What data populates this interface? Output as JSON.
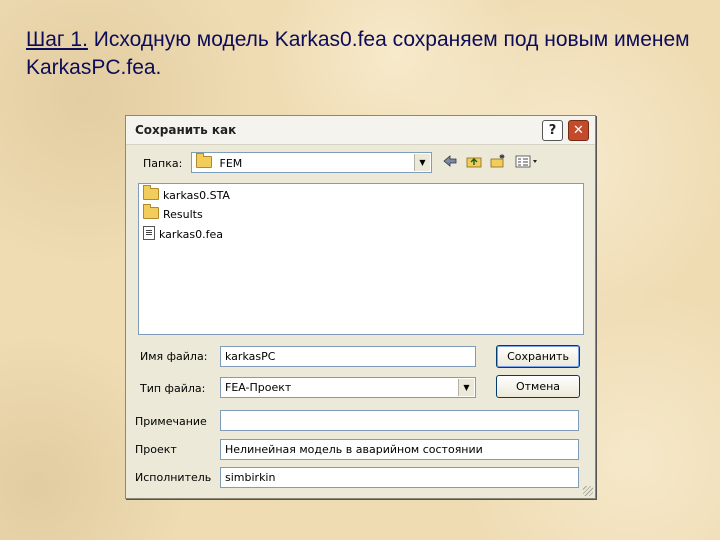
{
  "slide": {
    "step": "Шаг 1.",
    "text": " Исходную модель Karkas0.fea сохраняем под новым именем KarkasPC.fea."
  },
  "dialog": {
    "title": "Сохранить как",
    "help_label": "?",
    "close_label": "✕",
    "folder_label": "Папка:",
    "folder_value": "FEM",
    "toolbar_icons": [
      "back-icon",
      "up-folder-icon",
      "new-folder-icon",
      "view-menu-icon"
    ],
    "files": [
      {
        "name": "karkas0.STA",
        "icon": "folder-icon"
      },
      {
        "name": "Results",
        "icon": "folder-icon"
      },
      {
        "name": "karkas0.fea",
        "icon": "fea-file-icon"
      }
    ],
    "filename_label": "Имя файла:",
    "filename_value": "karkasPC",
    "filetype_label": "Тип файла:",
    "filetype_value": "FEA-Проект",
    "note_label": "Примечание",
    "note_value": "",
    "project_label": "Проект",
    "project_value": "Нелинейная модель в аварийном состоянии",
    "author_label": "Исполнитель",
    "author_value": "simbirkin",
    "save_label": "Сохранить",
    "cancel_label": "Отмена"
  }
}
